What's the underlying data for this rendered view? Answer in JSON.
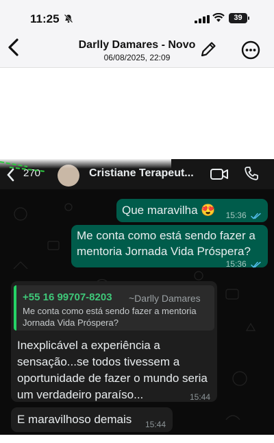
{
  "status_bar": {
    "time": "11:25",
    "battery": "39"
  },
  "viewer": {
    "title": "Darlly Damares - Novo",
    "subtitle": "06/08/2025, 22:09"
  },
  "chat": {
    "header": {
      "back_count": "270",
      "contact_name": "Cristiane Terapeut..."
    },
    "messages": [
      {
        "direction": "outgoing",
        "text": "Que maravilha 😍",
        "time": "15:36",
        "read": true
      },
      {
        "direction": "outgoing",
        "text": "Me conta como está sendo fazer a mentoria Jornada Vida Próspera?",
        "time": "15:36",
        "read": true
      },
      {
        "direction": "incoming",
        "quote_phone": "+55 16 99707-8203",
        "quote_name": "~Darlly Damares",
        "quote_text": "Me conta como está sendo fazer a mentoria Jornada Vida Próspera?",
        "text": "Inexplicável a experiência a sensação...se todos tivessem a oportunidade de fazer o mundo seria um verdadeiro paraíso...",
        "time": "15:44"
      },
      {
        "direction": "incoming",
        "text": "E maravilhoso demais",
        "time": "15:44"
      }
    ]
  },
  "colors": {
    "outgoing_bubble": "#005c4b",
    "incoming_bubble": "#1e1e1e",
    "chat_background": "#0b0b0b",
    "quote_accent": "#25d366",
    "read_ticks": "#53bdeb"
  },
  "icons": [
    "bell-slash-icon",
    "signal-icon",
    "wifi-icon",
    "battery-icon",
    "chevron-left-icon",
    "pencil-icon",
    "more-icon",
    "video-call-icon",
    "phone-icon"
  ]
}
